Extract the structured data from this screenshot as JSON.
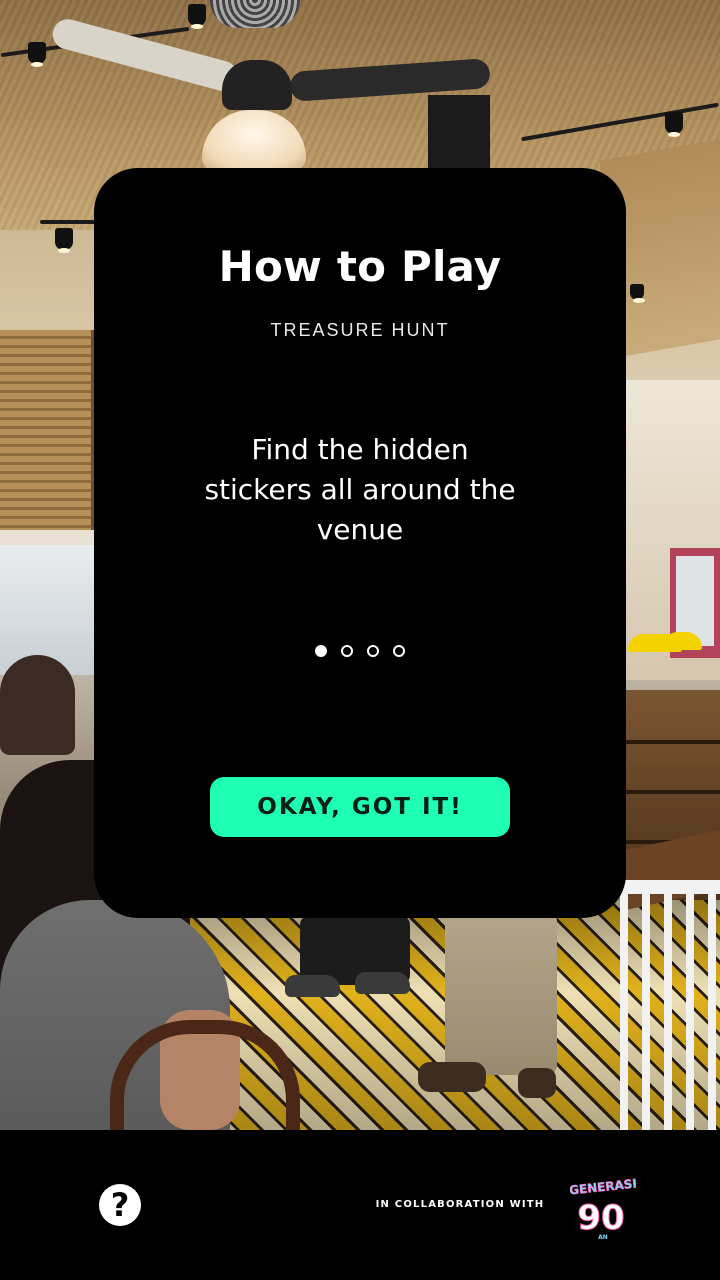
{
  "modal": {
    "title": "How to Play",
    "subtitle": "TREASURE HUNT",
    "description": "Find the hidden stickers all around the venue",
    "pagination": {
      "total": 4,
      "active_index": 0
    },
    "confirm_button_label": "OKAY, GOT IT!"
  },
  "footer": {
    "help_icon": "question-mark-icon",
    "help_glyph": "?",
    "collaboration_text": "IN COLLABORATION WITH",
    "partner_logo": {
      "name": "generasi-90an-logo",
      "wordmark": "GENERASI",
      "number": "90",
      "suffix": "AN"
    }
  },
  "colors": {
    "card_background": "#000000",
    "button_background": "#1fffb4",
    "button_text": "#062018",
    "text_primary": "#ffffff",
    "footer_background": "#000000"
  }
}
